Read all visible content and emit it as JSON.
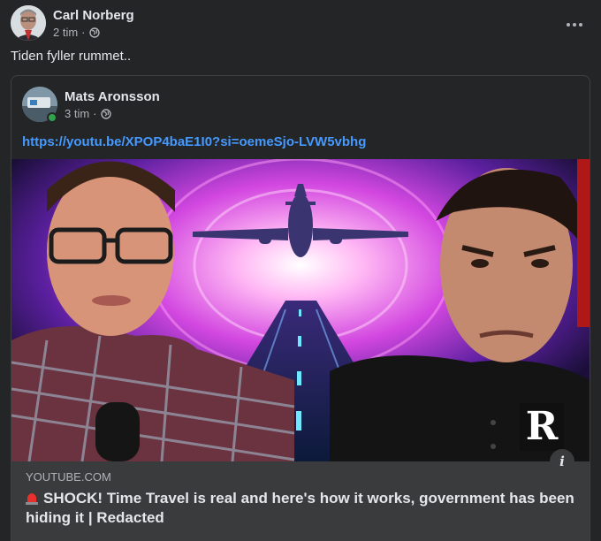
{
  "post": {
    "author": "Carl Norberg",
    "time": "2 tim",
    "separator": "·",
    "text": "Tiden fyller rummet.."
  },
  "shared": {
    "author": "Mats Aronsson",
    "time": "3 tim",
    "separator": "·",
    "link": "https://youtu.be/XPOP4baE1I0?si=oemeSjo-LVW5vbhg",
    "preview": {
      "domain": "YOUTUBE.COM",
      "title": "SHOCK! Time Travel is real and here's how it works, government has been hiding it | Redacted",
      "badge": "R"
    }
  },
  "icons": {
    "privacy": "globe-icon",
    "more": "more-options-icon",
    "info": "info-icon",
    "siren": "siren-icon"
  },
  "colors": {
    "background": "#242526",
    "link": "#4599ff",
    "preview_bg": "#3a3b3c",
    "online": "#31a24c"
  }
}
